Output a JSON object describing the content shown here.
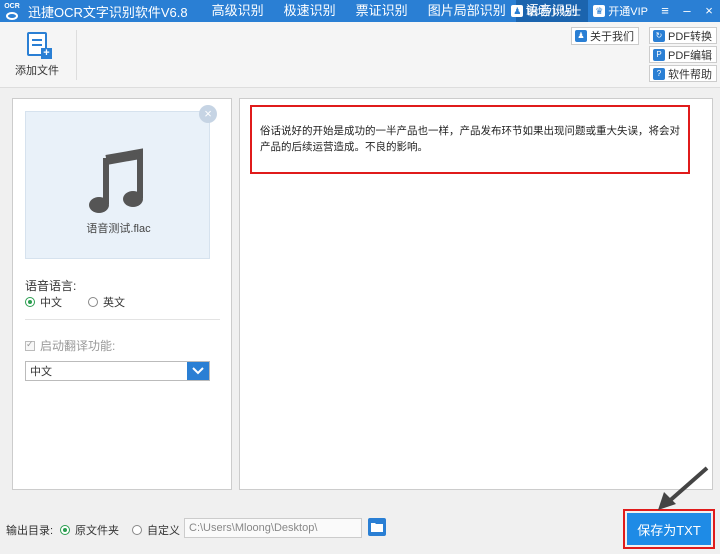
{
  "app": {
    "logo_text": "OCR",
    "title": "迅捷OCR文字识别软件V6.8",
    "tabs": [
      {
        "label": "高级识别"
      },
      {
        "label": "极速识别"
      },
      {
        "label": "票证识别"
      },
      {
        "label": "图片局部识别"
      },
      {
        "label": "语音识别",
        "active": true
      }
    ],
    "tips_label": "职场小贴士",
    "vip_label": "开通VIP",
    "accent_color": "#2a7fd4"
  },
  "toolbar": {
    "add_file_label": "添加文件",
    "about_label": "关于我们",
    "pdf_convert_label": "PDF转换",
    "pdf_edit_label": "PDF编辑",
    "help_label": "软件帮助"
  },
  "left_panel": {
    "file_name": "语音测试.flac",
    "language_label": "语音语言:",
    "language_options": [
      {
        "label": "中文",
        "selected": true
      },
      {
        "label": "英文",
        "selected": false
      }
    ],
    "translate_label": "启动翻译功能:",
    "translate_enabled": true,
    "translate_select_value": "中文"
  },
  "result": {
    "text": "俗话说好的开始是成功的一半产品也一样，产品发布环节如果出现问题或重大失误，将会对产品的后续运营造成。不良的影响。"
  },
  "bottom": {
    "output_label": "输出目录:",
    "option_original": "原文件夹",
    "option_custom": "自定义",
    "path_value": "C:\\Users\\Mloong\\Desktop\\",
    "save_label": "保存为TXT",
    "highlight_color": "#e01b1b"
  }
}
